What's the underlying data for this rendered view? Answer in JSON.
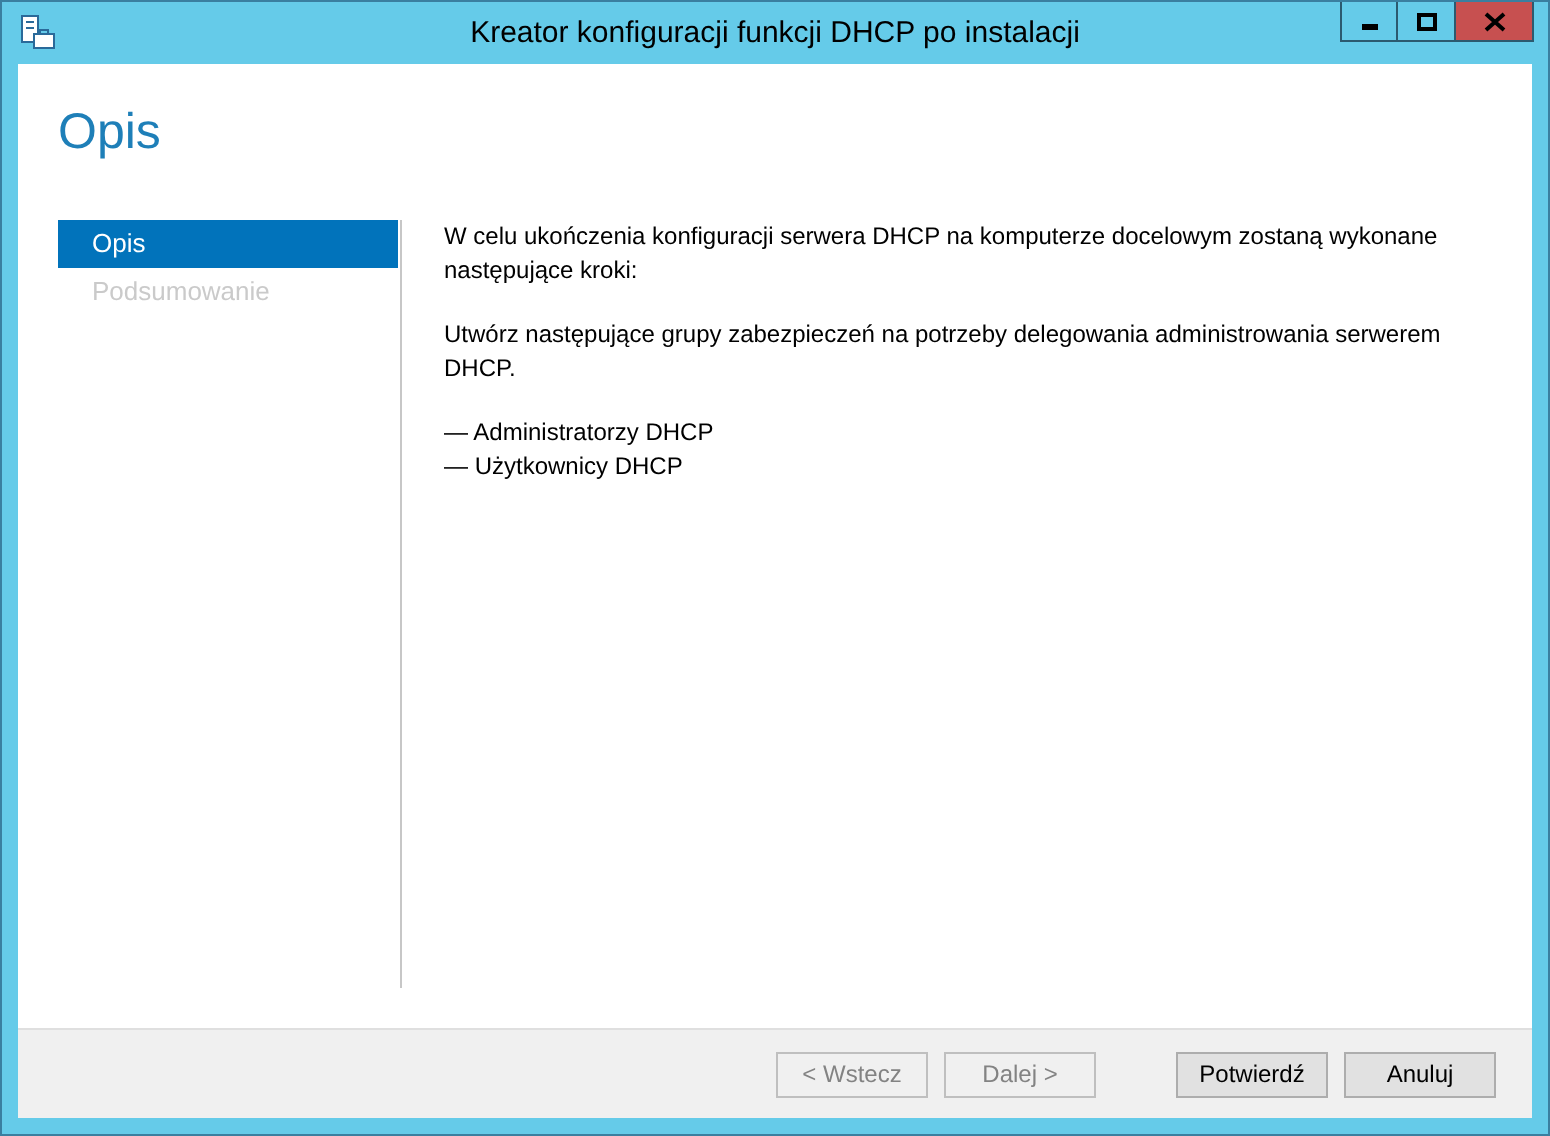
{
  "window": {
    "title": "Kreator konfiguracji funkcji DHCP po instalacji"
  },
  "heading": "Opis",
  "steps": [
    {
      "label": "Opis",
      "selected": true
    },
    {
      "label": "Podsumowanie",
      "selected": false
    }
  ],
  "content": {
    "paragraphs": [
      "W celu ukończenia konfiguracji serwera DHCP na komputerze docelowym zostaną wykonane następujące kroki:",
      "Utwórz następujące grupy zabezpieczeń na potrzeby delegowania administrowania serwerem DHCP."
    ],
    "groups": [
      "— Administratorzy DHCP",
      "— Użytkownicy DHCP"
    ]
  },
  "buttons": [
    {
      "label": "< Wstecz",
      "disabled": true
    },
    {
      "label": "Dalej >",
      "disabled": true
    },
    {
      "label": "Potwierdź",
      "disabled": false
    },
    {
      "label": "Anuluj",
      "disabled": false
    }
  ]
}
